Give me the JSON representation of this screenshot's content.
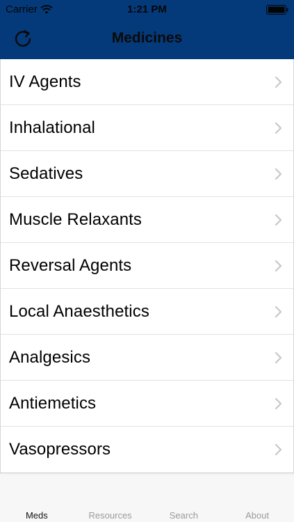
{
  "status_bar": {
    "carrier": "Carrier",
    "time": "1:21 PM"
  },
  "nav": {
    "title": "Medicines",
    "refresh_icon": "refresh-icon"
  },
  "list": {
    "items": [
      {
        "label": "IV Agents"
      },
      {
        "label": "Inhalational"
      },
      {
        "label": "Sedatives"
      },
      {
        "label": "Muscle Relaxants"
      },
      {
        "label": "Reversal Agents"
      },
      {
        "label": "Local Anaesthetics"
      },
      {
        "label": "Analgesics"
      },
      {
        "label": "Antiemetics"
      },
      {
        "label": "Vasopressors"
      }
    ]
  },
  "tab_bar": {
    "tabs": [
      {
        "label": "Meds",
        "active": true
      },
      {
        "label": "Resources",
        "active": false
      },
      {
        "label": "Search",
        "active": false
      },
      {
        "label": "About",
        "active": false
      }
    ]
  },
  "colors": {
    "header_bg": "#053a7a",
    "tab_active": "#111111",
    "tab_inactive": "#9a9a9a",
    "chevron": "#c7c7cc"
  }
}
